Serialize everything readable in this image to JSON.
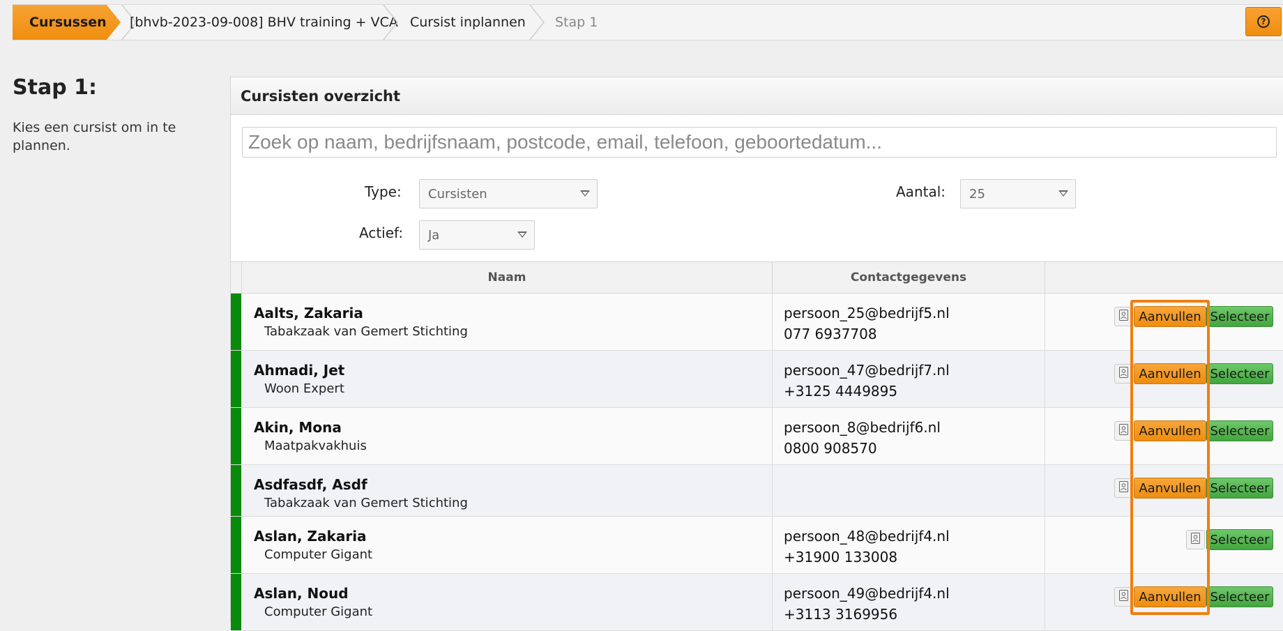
{
  "breadcrumb": {
    "home": "Cursussen",
    "course": "[bhvb-2023-09-008] BHV training + VCA",
    "action": "Cursist inplannen",
    "current": "Stap 1"
  },
  "help_icon": "question-circle-icon",
  "intro": {
    "title": "Stap 1:",
    "description": "Kies een cursist om in te plannen."
  },
  "panel": {
    "title": "Cursisten overzicht",
    "search_placeholder": "Zoek op naam, bedrijfsnaam, postcode, email, telefoon, geboortedatum...",
    "filters": {
      "type_label": "Type:",
      "type_value": "Cursisten",
      "aantal_label": "Aantal:",
      "aantal_value": "25",
      "actief_label": "Actief:",
      "actief_value": "Ja"
    },
    "columns": {
      "naam": "Naam",
      "contact": "Contactgegevens",
      "actions": ""
    }
  },
  "buttons": {
    "aanvullen": "Aanvullen",
    "selecteer": "Selecteer"
  },
  "rows": [
    {
      "name": "Aalts, Zakaria",
      "company": "Tabakzaak van Gemert Stichting",
      "email": "persoon_25@bedrijf5.nl",
      "phone": "077 6937708",
      "aanvullen": true
    },
    {
      "name": "Ahmadi, Jet",
      "company": "Woon Expert",
      "email": "persoon_47@bedrijf7.nl",
      "phone": "+3125 4449895",
      "aanvullen": true
    },
    {
      "name": "Akin, Mona",
      "company": "Maatpakvakhuis",
      "email": "persoon_8@bedrijf6.nl",
      "phone": "0800 908570",
      "aanvullen": true
    },
    {
      "name": "Asdfasdf, Asdf",
      "company": "Tabakzaak van Gemert Stichting",
      "email": "",
      "phone": "",
      "aanvullen": true
    },
    {
      "name": "Aslan, Zakaria",
      "company": "Computer Gigant",
      "email": "persoon_48@bedrijf4.nl",
      "phone": "+31900 133008",
      "aanvullen": false
    },
    {
      "name": "Aslan, Noud",
      "company": "Computer Gigant",
      "email": "persoon_49@bedrijf4.nl",
      "phone": "+3113 3169956",
      "aanvullen": true
    }
  ],
  "colors": {
    "accent_orange": "#f08e0f",
    "select_green": "#42a63d",
    "row_status_green": "#0a8a0a",
    "highlight_orange": "#f07f10"
  }
}
